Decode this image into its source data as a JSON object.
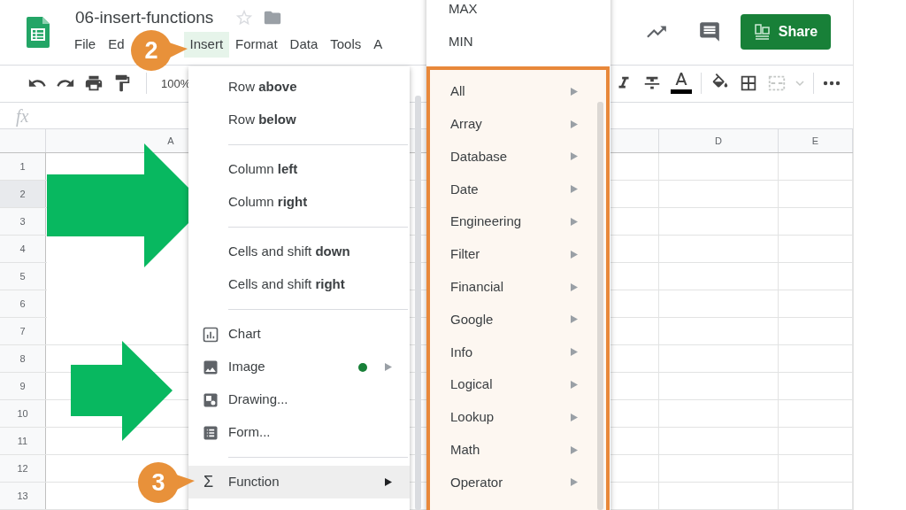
{
  "app": {
    "title": "06-insert-functions",
    "starred": false
  },
  "menu_bar": [
    {
      "label": "File",
      "selected": false
    },
    {
      "label": "Ed",
      "selected": false
    },
    {
      "label": "Insert",
      "selected": true
    },
    {
      "label": "Format",
      "selected": false
    },
    {
      "label": "Data",
      "selected": false
    },
    {
      "label": "Tools",
      "selected": false
    },
    {
      "label": "A",
      "selected": false
    }
  ],
  "share_button": "Share",
  "toolbar": {
    "zoom": "100%"
  },
  "formula_bar": {
    "label": "fx"
  },
  "columns": [
    {
      "label": "A"
    },
    {
      "label": "D"
    },
    {
      "label": "E"
    }
  ],
  "rows": [
    {
      "label": "1",
      "selected": false
    },
    {
      "label": "2",
      "selected": true
    },
    {
      "label": "3",
      "selected": false
    },
    {
      "label": "4",
      "selected": false
    },
    {
      "label": "5",
      "selected": false
    },
    {
      "label": "6",
      "selected": false
    },
    {
      "label": "7",
      "selected": false
    },
    {
      "label": "8",
      "selected": false
    },
    {
      "label": "9",
      "selected": false
    },
    {
      "label": "10",
      "selected": false
    },
    {
      "label": "11",
      "selected": false
    },
    {
      "label": "12",
      "selected": false
    },
    {
      "label": "13",
      "selected": false
    }
  ],
  "insert_menu": [
    {
      "kind": "text",
      "label": "Row **above**",
      "selected": false
    },
    {
      "kind": "text",
      "label": "Row **below**",
      "selected": false
    },
    {
      "kind": "divider"
    },
    {
      "kind": "text",
      "label": "Column **left**",
      "selected": false
    },
    {
      "kind": "text",
      "label": "Column **right**",
      "selected": false
    },
    {
      "kind": "divider"
    },
    {
      "kind": "text",
      "label": "Cells and shift **down**",
      "selected": false
    },
    {
      "kind": "text",
      "label": "Cells and shift **right**",
      "selected": false
    },
    {
      "kind": "divider"
    },
    {
      "kind": "chart",
      "label": "Chart",
      "selected": false
    },
    {
      "kind": "image",
      "label": "Image",
      "new": true,
      "submenu": true,
      "selected": false
    },
    {
      "kind": "drawing",
      "label": "Drawing...",
      "selected": false
    },
    {
      "kind": "form",
      "label": "Form...",
      "selected": false
    },
    {
      "kind": "divider"
    },
    {
      "kind": "glyph",
      "glyph": "Σ",
      "label": "Function",
      "submenu": true,
      "selected": true
    }
  ],
  "function_menu": {
    "functions": [
      {
        "label": "MAX"
      },
      {
        "label": "MIN"
      }
    ],
    "categories": [
      {
        "label": "All",
        "submenu": true
      },
      {
        "label": "Array",
        "submenu": true
      },
      {
        "label": "Database",
        "submenu": true
      },
      {
        "label": "Date",
        "submenu": true
      },
      {
        "label": "Engineering",
        "submenu": true
      },
      {
        "label": "Filter",
        "submenu": true
      },
      {
        "label": "Financial",
        "submenu": true
      },
      {
        "label": "Google",
        "submenu": true
      },
      {
        "label": "Info",
        "submenu": true
      },
      {
        "label": "Logical",
        "submenu": true
      },
      {
        "label": "Lookup",
        "submenu": true
      },
      {
        "label": "Math",
        "submenu": true
      },
      {
        "label": "Operator",
        "submenu": true
      }
    ]
  },
  "callouts": [
    {
      "label": "2"
    },
    {
      "label": "3"
    }
  ]
}
